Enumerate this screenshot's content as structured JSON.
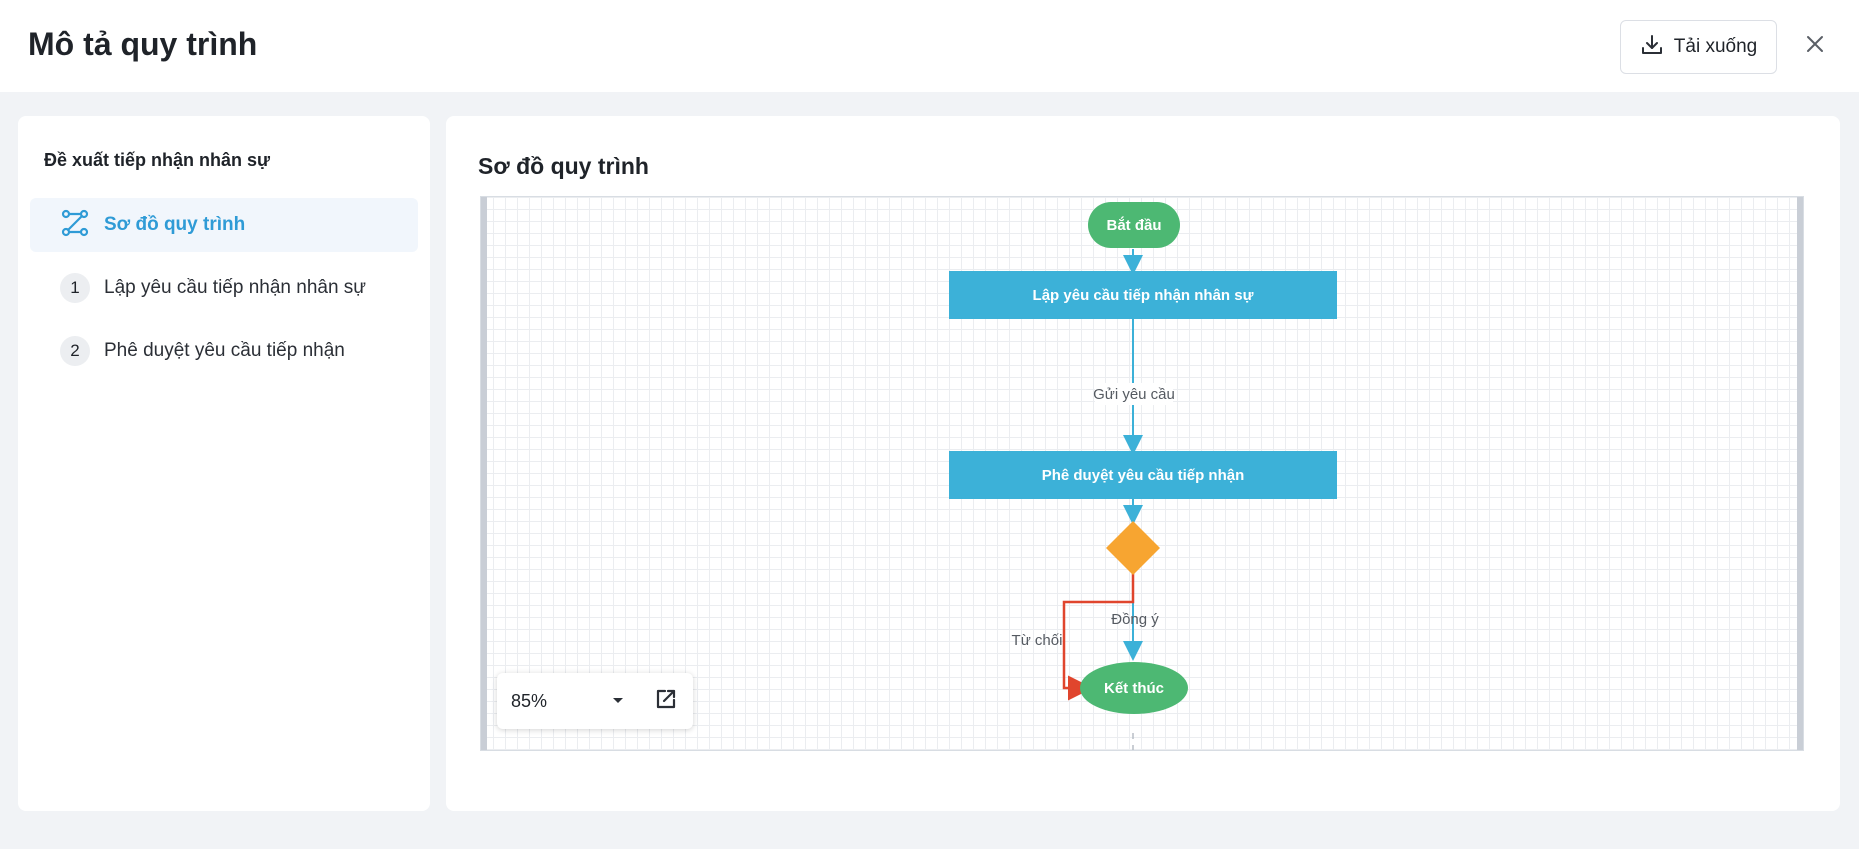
{
  "header": {
    "title": "Mô tả quy trình",
    "download_label": "Tải xuống"
  },
  "sidebar": {
    "title": "Đề xuất tiếp nhận nhân sự",
    "items": [
      {
        "label": "Sơ đồ quy trình",
        "icon": "flow-diagram-icon",
        "active": true
      },
      {
        "number": "1",
        "label": "Lập yêu cầu tiếp nhận nhân sự"
      },
      {
        "number": "2",
        "label": "Phê duyệt yêu cầu tiếp nhận"
      }
    ]
  },
  "main": {
    "title": "Sơ đồ quy trình",
    "diagram": {
      "nodes": {
        "start": "Bắt đầu",
        "step1": "Lập yêu cầu tiếp nhận nhân sự",
        "step2": "Phê duyệt yêu cầu tiếp nhận",
        "end": "Kết thúc"
      },
      "edges": {
        "send": "Gửi yêu cầu",
        "agree": "Đồng ý",
        "reject": "Từ chối"
      }
    },
    "zoom": {
      "value": "85%"
    }
  },
  "colors": {
    "start_end": "#4db873",
    "step": "#3cb1d8",
    "decision": "#f7a531",
    "reject_line": "#e0452d",
    "accent": "#2f9bd6"
  }
}
